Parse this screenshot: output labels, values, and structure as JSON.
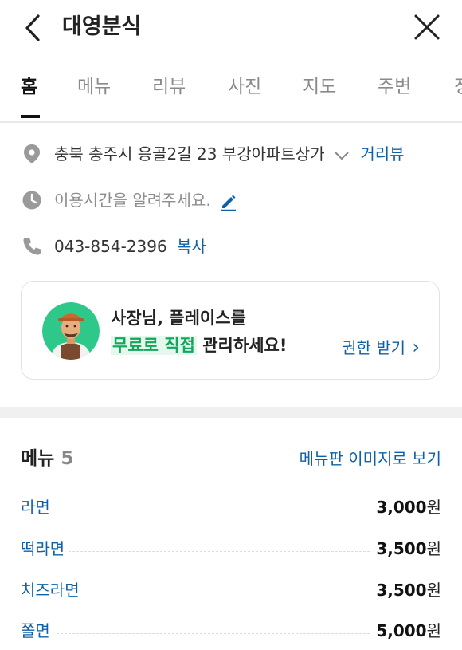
{
  "header": {
    "title": "대영분식"
  },
  "tabs": [
    {
      "label": "홈"
    },
    {
      "label": "메뉴"
    },
    {
      "label": "리뷰"
    },
    {
      "label": "사진"
    },
    {
      "label": "지도"
    },
    {
      "label": "주변"
    },
    {
      "label": "정"
    }
  ],
  "info": {
    "address": "충북 충주시 응골2길 23 부강아파트상가",
    "street_view": "거리뷰",
    "hours_prompt": "이용시간을 알려주세요.",
    "phone": "043-854-2396",
    "copy": "복사"
  },
  "banner": {
    "line1": "사장님, 플레이스를",
    "highlight": "무료로 직접",
    "line2_rest": " 관리하세요!",
    "cta": "권한 받기",
    "cta_arrow": "›"
  },
  "menu": {
    "heading": "메뉴",
    "count": "5",
    "view_board": "메뉴판 이미지로 보기",
    "items": [
      {
        "name": "라면",
        "price": "3,000",
        "unit": "원"
      },
      {
        "name": "떡라면",
        "price": "3,500",
        "unit": "원"
      },
      {
        "name": "치즈라면",
        "price": "3,500",
        "unit": "원"
      },
      {
        "name": "쫄면",
        "price": "5,000",
        "unit": "원"
      }
    ]
  },
  "colors": {
    "link": "#0e61a8",
    "highlight": "#12a85c",
    "icon": "#9a9a9a"
  }
}
